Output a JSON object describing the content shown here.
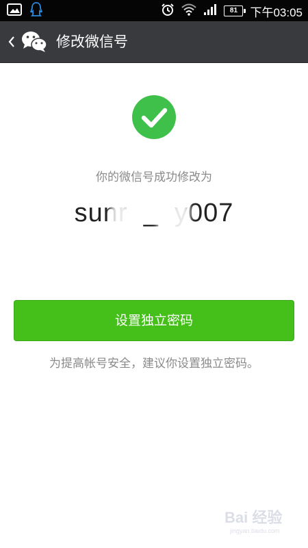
{
  "status_bar": {
    "time": "下午03:05",
    "battery": "81",
    "icons": [
      "image-icon",
      "qq-icon",
      "alarm-icon",
      "wifi-icon",
      "signal-icon",
      "battery-icon"
    ]
  },
  "action_bar": {
    "title": "修改微信号",
    "back_icon": "chevron-left-icon",
    "logo": "wechat-logo-icon"
  },
  "main": {
    "success_icon": "checkmark-circle-icon",
    "success_message": "你的微信号成功修改为",
    "wechat_id": "sunr  _  y007",
    "button_label": "设置独立密码",
    "hint": "为提高帐号安全，建议你设置独立密码。"
  },
  "watermark": {
    "text": "Bai 经验",
    "url": "jingyan.baidu.com"
  },
  "colors": {
    "status_bar_bg": "#050505",
    "action_bar_bg": "#383a3d",
    "accent_green": "#45c01a",
    "success_green": "#3fc04a",
    "secondary_text": "#8a8a8a"
  }
}
